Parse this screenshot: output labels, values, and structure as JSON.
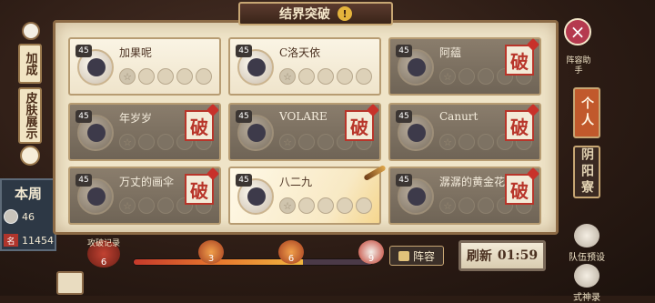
{
  "title": "结界突破",
  "title_alert": "!",
  "cards": [
    {
      "name": "加果呢",
      "level": "45",
      "state": "active",
      "stamp": ""
    },
    {
      "name": "C洛天依",
      "level": "45",
      "state": "active",
      "stamp": ""
    },
    {
      "name": "阿藴",
      "level": "45",
      "state": "broken",
      "stamp": "破"
    },
    {
      "name": "年岁岁",
      "level": "45",
      "state": "broken",
      "stamp": "破"
    },
    {
      "name": "VOLARE",
      "level": "45",
      "state": "broken",
      "stamp": "破"
    },
    {
      "name": "Canurt",
      "level": "45",
      "state": "broken",
      "stamp": "破"
    },
    {
      "name": "万丈的画伞",
      "level": "45",
      "state": "broken",
      "stamp": "破"
    },
    {
      "name": "八二九",
      "level": "45",
      "state": "glow",
      "stamp": ""
    },
    {
      "name": "潺潺的黄金花",
      "level": "45",
      "state": "broken",
      "stamp": "破"
    }
  ],
  "left": {
    "tab_add": "加成",
    "tab_skin": "皮肤展示",
    "week_label": "本周",
    "coins": "46",
    "rank_label": "排名",
    "rank": "11454"
  },
  "right": {
    "close": "×",
    "helper": "阵容助手",
    "tab_personal": "个人",
    "tab_guild": "阴阳寮",
    "team_preset": "队伍预设",
    "shikigami_record": "式神录"
  },
  "bottom": {
    "record_label": "攻破记录",
    "record_value": "6",
    "progress": 0.71,
    "milestones": [
      "3",
      "6",
      "9"
    ],
    "lineup": "阵容",
    "refresh_label": "刷新",
    "refresh_time": "01:59"
  },
  "icons": {
    "close": "close-icon",
    "stamp": "po-stamp-icon",
    "star": "star-icon"
  }
}
